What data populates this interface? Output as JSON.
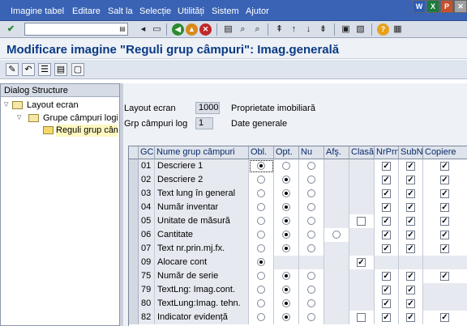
{
  "menu": [
    "Imagine tabel",
    "Editare",
    "Salt la",
    "Selecție",
    "Utilități",
    "Sistem",
    "Ajutor"
  ],
  "window_icons": [
    {
      "name": "word-icon",
      "label": "W",
      "color": "#2b5cb8"
    },
    {
      "name": "excel-icon",
      "label": "X",
      "color": "#1e7a3c"
    },
    {
      "name": "powerpoint-icon",
      "label": "P",
      "color": "#c8502c"
    },
    {
      "name": "close-icon",
      "label": "✕",
      "color": "#a0a0a0"
    }
  ],
  "title": "Modificare imagine \"Reguli grup câmpuri\": Imag.generală",
  "dialog": {
    "header": "Dialog Structure",
    "items": [
      {
        "label": "Layout ecran"
      },
      {
        "label": "Grupe câmpuri logice"
      },
      {
        "label": "Reguli grup câmp"
      }
    ]
  },
  "header_fields": {
    "layout_label": "Layout ecran",
    "layout_value": "1000",
    "layout_desc": "Proprietate imobiliară",
    "group_label": "Grp câmpuri log",
    "group_value": "1",
    "group_desc": "Date generale"
  },
  "table": {
    "columns": [
      "GC",
      "Nume grup câmpuri",
      "Obl.",
      "Opt.",
      "Nu",
      "Afş.",
      "Clasă",
      "NrPrn",
      "SubNr",
      "Copiere"
    ],
    "rows": [
      {
        "gc": "01",
        "name": "Descriere 1",
        "obl": true,
        "opt": false,
        "nu": false,
        "afs": null,
        "clasa": null,
        "nrprn": true,
        "subnr": true,
        "copiere": true
      },
      {
        "gc": "02",
        "name": "Descriere 2",
        "obl": false,
        "opt": true,
        "nu": false,
        "afs": null,
        "clasa": null,
        "nrprn": true,
        "subnr": true,
        "copiere": true
      },
      {
        "gc": "03",
        "name": "Text lung în general",
        "obl": false,
        "opt": true,
        "nu": false,
        "afs": null,
        "clasa": null,
        "nrprn": true,
        "subnr": true,
        "copiere": true
      },
      {
        "gc": "04",
        "name": "Număr inventar",
        "obl": false,
        "opt": true,
        "nu": false,
        "afs": null,
        "clasa": null,
        "nrprn": true,
        "subnr": true,
        "copiere": true
      },
      {
        "gc": "05",
        "name": "Unitate de măsură",
        "obl": false,
        "opt": true,
        "nu": false,
        "afs": null,
        "clasa": false,
        "nrprn": true,
        "subnr": true,
        "copiere": true
      },
      {
        "gc": "06",
        "name": "Cantitate",
        "obl": false,
        "opt": true,
        "nu": false,
        "afs": false,
        "clasa": null,
        "nrprn": true,
        "subnr": true,
        "copiere": true
      },
      {
        "gc": "07",
        "name": "Text nr.prin.mj.fx.",
        "obl": false,
        "opt": true,
        "nu": false,
        "afs": null,
        "clasa": null,
        "nrprn": true,
        "subnr": true,
        "copiere": true
      },
      {
        "gc": "09",
        "name": "Alocare cont",
        "obl": true,
        "opt": null,
        "nu": null,
        "afs": null,
        "clasa": true,
        "nrprn": null,
        "subnr": null,
        "copiere": null
      },
      {
        "gc": "75",
        "name": "Număr de serie",
        "obl": false,
        "opt": true,
        "nu": false,
        "afs": null,
        "clasa": null,
        "nrprn": true,
        "subnr": true,
        "copiere": true
      },
      {
        "gc": "79",
        "name": "TextLng: Imag.cont.",
        "obl": false,
        "opt": true,
        "nu": false,
        "afs": null,
        "clasa": null,
        "nrprn": true,
        "subnr": true,
        "copiere": null
      },
      {
        "gc": "80",
        "name": "TextLung:Imag. tehn.",
        "obl": false,
        "opt": true,
        "nu": false,
        "afs": null,
        "clasa": null,
        "nrprn": true,
        "subnr": true,
        "copiere": null
      },
      {
        "gc": "82",
        "name": "Indicator evidență",
        "obl": false,
        "opt": true,
        "nu": false,
        "afs": null,
        "clasa": false,
        "nrprn": true,
        "subnr": true,
        "copiere": true
      }
    ]
  }
}
